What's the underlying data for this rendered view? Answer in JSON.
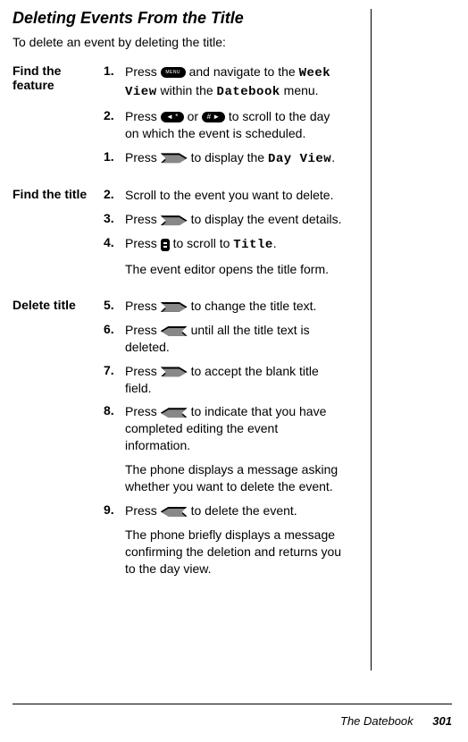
{
  "title": "Deleting Events From the Title",
  "intro": "To delete an event by deleting the title:",
  "sections": [
    {
      "label": "Find the feature",
      "steps": [
        {
          "num": "1.",
          "t1": "Press ",
          "k1": "MENU",
          "t2": " and navigate to the ",
          "m1": "Week View",
          "t3": " within the ",
          "m2": "Datebook",
          "t4": " menu."
        },
        {
          "num": "2.",
          "t1": "Press ",
          "k1": "◄ *",
          "t2": " or ",
          "k2": "# ►",
          "t3": " to scroll to the day on which the event is scheduled."
        },
        {
          "num": "1.",
          "t1": "Press ",
          "t2": " to display the ",
          "m1": "Day View",
          "t3": "."
        }
      ]
    },
    {
      "label": "Find the title",
      "steps": [
        {
          "num": "2.",
          "t1": "Scroll to the event you want to delete."
        },
        {
          "num": "3.",
          "t1": "Press ",
          "t2": " to display the event details."
        },
        {
          "num": "4.",
          "t1": "Press ",
          "t2": " to scroll to ",
          "m1": "Title",
          "t3": "."
        }
      ],
      "after": "The event editor opens the title form."
    },
    {
      "label": "Delete title",
      "steps": [
        {
          "num": "5.",
          "t1": "Press ",
          "t2": " to change the title text."
        },
        {
          "num": "6.",
          "t1": "Press ",
          "t2": " until all the title text is deleted."
        },
        {
          "num": "7.",
          "t1": "Press ",
          "t2": " to accept the blank title field."
        },
        {
          "num": "8.",
          "t1": "Press ",
          "t2": " to indicate that you have completed editing the event information."
        },
        {
          "num": "9.",
          "t1": "Press ",
          "t2": " to delete the event."
        }
      ],
      "after1": "The phone displays a message asking whether you want to delete the event.",
      "after2": "The phone briefly displays a message confirming the deletion and returns you to the day view."
    }
  ],
  "footer": {
    "doc": "The Datebook",
    "page": "301"
  }
}
